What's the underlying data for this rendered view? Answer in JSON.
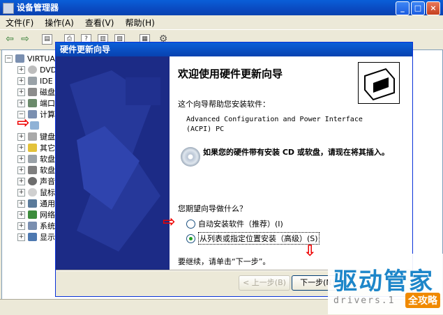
{
  "device_manager": {
    "title": "设备管理器",
    "menu": [
      "文件(F)",
      "操作(A)",
      "查看(V)",
      "帮助(H)"
    ],
    "tree": [
      {
        "label": "VIRTUAL",
        "expander": "⊟",
        "indent": 0
      },
      {
        "label": "DVD",
        "expander": "⊞",
        "indent": 1
      },
      {
        "label": "IDE",
        "expander": "⊞",
        "indent": 1
      },
      {
        "label": "磁盘",
        "expander": "⊞",
        "indent": 1
      },
      {
        "label": "端口",
        "expander": "⊞",
        "indent": 1
      },
      {
        "label": "计算",
        "expander": "⊟",
        "indent": 1
      },
      {
        "label": "",
        "expander": "",
        "indent": 2
      },
      {
        "label": "键盘",
        "expander": "⊞",
        "indent": 1
      },
      {
        "label": "其它",
        "expander": "⊞",
        "indent": 1
      },
      {
        "label": "软盘",
        "expander": "⊞",
        "indent": 1
      },
      {
        "label": "软盘",
        "expander": "⊞",
        "indent": 1
      },
      {
        "label": "声音",
        "expander": "⊞",
        "indent": 1
      },
      {
        "label": "鼠标",
        "expander": "⊞",
        "indent": 1
      },
      {
        "label": "通用",
        "expander": "⊞",
        "indent": 1
      },
      {
        "label": "网络",
        "expander": "⊞",
        "indent": 1
      },
      {
        "label": "系统",
        "expander": "⊞",
        "indent": 1
      },
      {
        "label": "显示",
        "expander": "⊞",
        "indent": 1
      }
    ]
  },
  "wizard": {
    "title": "硬件更新向导",
    "heading": "欢迎使用硬件更新向导",
    "description": "这个向导帮助您安装软件：",
    "device_line1": "Advanced Configuration and Power Interface",
    "device_line2": "(ACPI) PC",
    "cd_hint": "如果您的硬件带有安装 CD 或软盘，请现在将其插入。",
    "question": "您期望向导做什么？",
    "options": [
      {
        "label": "自动安装软件（推荐）(I)",
        "selected": false
      },
      {
        "label": "从列表或指定位置安装（高级）(S)",
        "selected": true
      }
    ],
    "continue_hint": "要继续，请单击“下一步”。",
    "back_button": "< 上一步(B)",
    "next_button": "下一步(N)"
  },
  "watermark": {
    "brand": "驱动管家",
    "url": "drivers.1",
    "badge": "全攻略"
  }
}
